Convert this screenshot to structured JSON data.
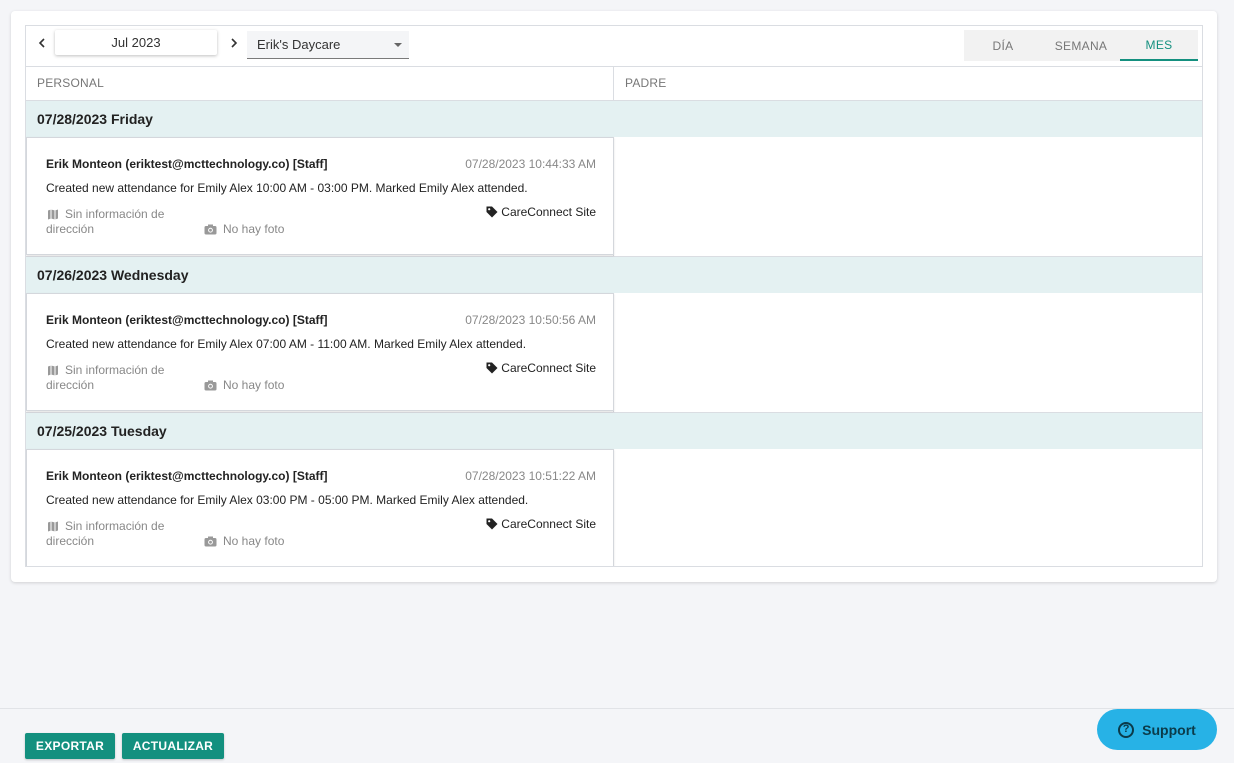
{
  "toolbar": {
    "prev_icon": "chevron-left-icon",
    "next_icon": "chevron-right-icon",
    "date": "Jul 2023",
    "location": "Erik's Daycare",
    "tabs": [
      {
        "label": "DÍA",
        "active": false
      },
      {
        "label": "SEMANA",
        "active": false
      },
      {
        "label": "MES",
        "active": true
      }
    ]
  },
  "columns": {
    "staff": "PERSONAL",
    "parent": "PADRE"
  },
  "days": [
    {
      "header": "07/28/2023 Friday",
      "entry": {
        "user": "Erik Monteon (eriktest@mcttechnology.co) [Staff]",
        "timestamp": "07/28/2023 10:44:33 AM",
        "message": "Created new attendance for Emily Alex 10:00 AM - 03:00 PM. Marked Emily Alex attended.",
        "location": "Sin información de dirección",
        "photo": "No hay foto",
        "site": "CareConnect Site"
      }
    },
    {
      "header": "07/26/2023 Wednesday",
      "entry": {
        "user": "Erik Monteon (eriktest@mcttechnology.co) [Staff]",
        "timestamp": "07/28/2023 10:50:56 AM",
        "message": "Created new attendance for Emily Alex 07:00 AM - 11:00 AM. Marked Emily Alex attended.",
        "location": "Sin información de dirección",
        "photo": "No hay foto",
        "site": "CareConnect Site"
      }
    },
    {
      "header": "07/25/2023 Tuesday",
      "entry": {
        "user": "Erik Monteon (eriktest@mcttechnology.co) [Staff]",
        "timestamp": "07/28/2023 10:51:22 AM",
        "message": "Created new attendance for Emily Alex 03:00 PM - 05:00 PM. Marked Emily Alex attended.",
        "location": "Sin información de dirección",
        "photo": "No hay foto",
        "site": "CareConnect Site"
      }
    }
  ],
  "footer": {
    "export_label": "EXPORTAR",
    "refresh_label": "ACTUALIZAR"
  },
  "support": {
    "label": "Support",
    "icon": "question-circle-icon"
  },
  "colors": {
    "accent": "#13907f",
    "day_header_bg": "#e4f1f2",
    "support_bg": "#27b2e6"
  }
}
